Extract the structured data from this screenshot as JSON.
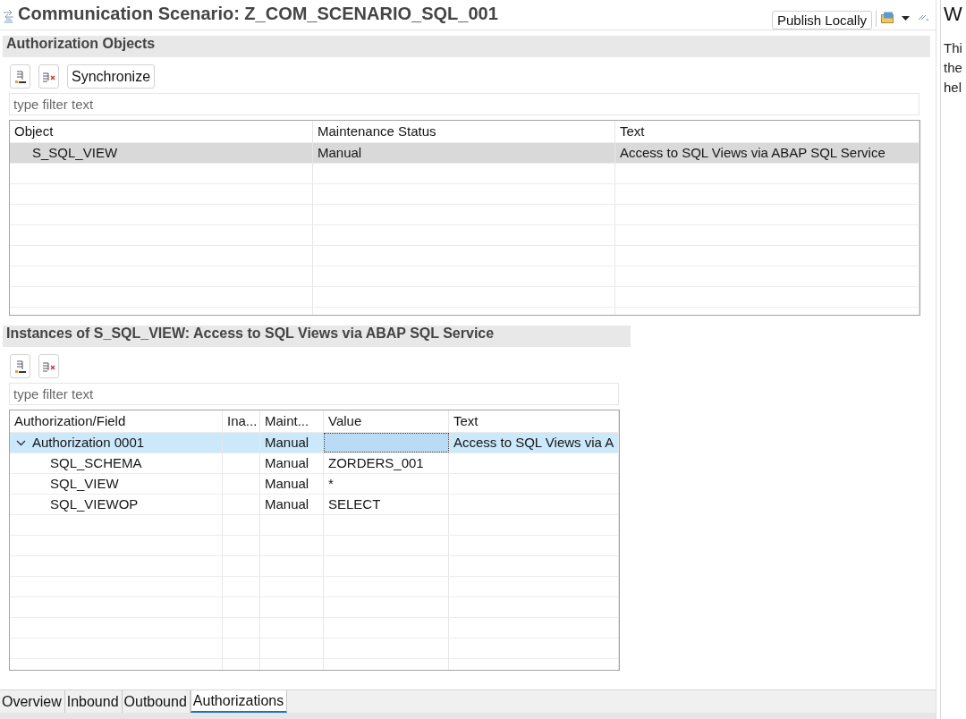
{
  "editor": {
    "title": "Communication Scenario: Z_COM_SCENARIO_SQL_001",
    "publish_button": "Publish Locally"
  },
  "authorization_objects": {
    "header": "Authorization Objects",
    "sync_button": "Synchronize",
    "filter": {
      "placeholder": "type filter text"
    },
    "table": {
      "focused": false,
      "columns": [
        "Object",
        "Maintenance Status",
        "Text"
      ],
      "rows": [
        {
          "object": "S_SQL_VIEW",
          "maintenance_status": "Manual",
          "text": "Access to SQL Views via ABAP SQL Service",
          "selected": true
        }
      ]
    }
  },
  "instances": {
    "header": "Instances of S_SQL_VIEW: Access to SQL Views via ABAP SQL Service",
    "filter": {
      "placeholder": "type filter text"
    },
    "table": {
      "focused": true,
      "columns": [
        "Authorization/Field",
        "Ina...",
        "Maint...",
        "Value",
        "Text"
      ],
      "rows": [
        {
          "authorization_field": "Authorization 0001",
          "column_3": "Manual",
          "text": "Access to SQL Views via A",
          "selected": true,
          "expanded": true,
          "value_focused": true,
          "children": [
            {
              "authorization_field": "SQL_SCHEMA",
              "column_3": "Manual",
              "value": "ZORDERS_001",
              "selected": false,
              "value_focused": false
            },
            {
              "authorization_field": "SQL_VIEW",
              "column_3": "Manual",
              "value": "*",
              "selected": false,
              "value_focused": false
            },
            {
              "authorization_field": "SQL_VIEWOP",
              "column_3": "Manual",
              "value": "SELECT",
              "selected": false,
              "value_focused": false
            }
          ]
        }
      ]
    }
  },
  "tabs": [
    {
      "label": "Overview",
      "selected": false
    },
    {
      "label": "Inbound",
      "selected": false
    },
    {
      "label": "Outbound",
      "selected": false
    },
    {
      "label": "Authorizations",
      "selected": true
    }
  ],
  "side_panel": {
    "title": "W",
    "lines": [
      "Thi",
      "the",
      "hel"
    ]
  }
}
